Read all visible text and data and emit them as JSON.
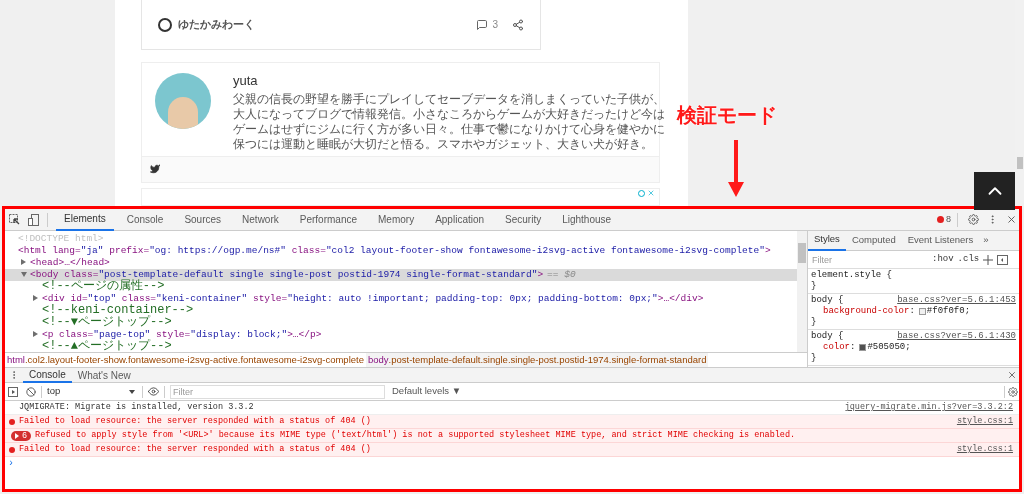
{
  "page": {
    "post_card": {
      "site_name": "ゆたかみわーく",
      "comment_count": "3"
    },
    "author": {
      "name": "yuta",
      "bio": "父親の信長の野望を勝手にプレイしてセーブデータを消しまくっていた子供が、大人になってブログで情報発信。小さなころからゲームが大好きだったけど今はゲームはせずにジムに行く方が多い日々。仕事で鬱になりかけて心身を健やかに保つには運動と睡眠が大切だと悟る。スマホやガジェット、大きい犬が好き。"
    },
    "annotation": "検証モード"
  },
  "devtools": {
    "tabs": [
      {
        "label": "Elements",
        "selected": true
      },
      {
        "label": "Console",
        "selected": false
      },
      {
        "label": "Sources",
        "selected": false
      },
      {
        "label": "Network",
        "selected": false
      },
      {
        "label": "Performance",
        "selected": false
      },
      {
        "label": "Memory",
        "selected": false
      },
      {
        "label": "Application",
        "selected": false
      },
      {
        "label": "Security",
        "selected": false
      },
      {
        "label": "Lighthouse",
        "selected": false
      }
    ],
    "error_count": "8",
    "dom": [
      {
        "kind": "doctype",
        "text": "<!DOCTYPE html>"
      },
      {
        "kind": "tag",
        "text": "<html lang=\"ja\" prefix=\"og: https://ogp.me/ns#\" class=\"col2 layout-footer-show fontawesome-i2svg-active fontawesome-i2svg-complete\">",
        "children": [
          {
            "kind": "tag",
            "text": "<head>…</head>",
            "expanded": false,
            "selected": false
          },
          {
            "kind": "tag",
            "text": "<body class=\"post-template-default single single-post postid-1974 single-format-standard\">",
            "suffix": "== $0",
            "expanded": true,
            "selected": true,
            "children": [
              {
                "kind": "comment",
                "text": "<!--ページの属性-->"
              },
              {
                "kind": "tag",
                "text": "<div id=\"top\" class=\"keni-container\" style=\"height: auto !important; padding-top: 0px; padding-bottom: 0px;\">…</div>",
                "expanded": false,
                "selected": false
              },
              {
                "kind": "comment",
                "text": "<!--keni-container-->"
              },
              {
                "kind": "comment",
                "text": "<!--▼ページトップ-->"
              },
              {
                "kind": "tag",
                "text": "<p class=\"page-top\" style=\"display: block;\">…</p>",
                "expanded": false,
                "selected": false
              },
              {
                "kind": "comment",
                "text": "<!--▲ページトップ-->"
              }
            ]
          }
        ]
      }
    ],
    "breadcrumbs": [
      {
        "tag": "html",
        "classes": ".col2.layout-footer-show.fontawesome-i2svg-active.fontawesome-i2svg-complete",
        "selected": false
      },
      {
        "tag": "body",
        "classes": ".post-template-default.single.single-post.postid-1974.single-format-standard",
        "selected": true
      }
    ],
    "side_tabs": [
      {
        "label": "Styles",
        "selected": true
      },
      {
        "label": "Computed",
        "selected": false
      },
      {
        "label": "Event Listeners",
        "selected": false
      }
    ],
    "side_more": "»",
    "styles_filter": {
      "placeholder": "Filter"
    },
    "hov": ":hov",
    "cls": ".cls",
    "rules": [
      {
        "selector": "element.style {",
        "close": "}"
      },
      {
        "selector": "body {",
        "source": "base.css?ver=5.6.1:453",
        "declarations": [
          {
            "property": "background-color",
            "colon": ":",
            "value": "#f0f0f0",
            "end": ";"
          }
        ],
        "close": "}"
      },
      {
        "selector": "body {",
        "source": "base.css?ver=5.6.1:430",
        "declarations": [
          {
            "property": "color",
            "colon": ":",
            "value": "#505050",
            "end": ";"
          }
        ],
        "close": "}"
      }
    ],
    "drawer_tabs": [
      {
        "label": "Console",
        "selected": true
      },
      {
        "label": "What's New",
        "selected": false
      }
    ],
    "context": "top",
    "console_filter": {
      "placeholder": "Filter"
    },
    "levels": "Default levels ▼",
    "messages": [
      {
        "kind": "info",
        "text": "JQMIGRATE: Migrate is installed, version 3.3.2",
        "source": "jquery-migrate.min.js?ver=3.3.2:2"
      },
      {
        "kind": "error",
        "text": "Failed to load resource: the server responded with a status of 404 ()",
        "source": "style.css:1"
      },
      {
        "kind": "error",
        "count": "6",
        "text": "Refused to apply style from '<URL>' because its MIME type ('text/html') is not a supported stylesheet MIME type, and strict MIME checking is enabled."
      },
      {
        "kind": "error",
        "text": "Failed to load resource: the server responded with a status of 404 ()",
        "source": "style.css:1"
      }
    ],
    "prompt": "›"
  }
}
